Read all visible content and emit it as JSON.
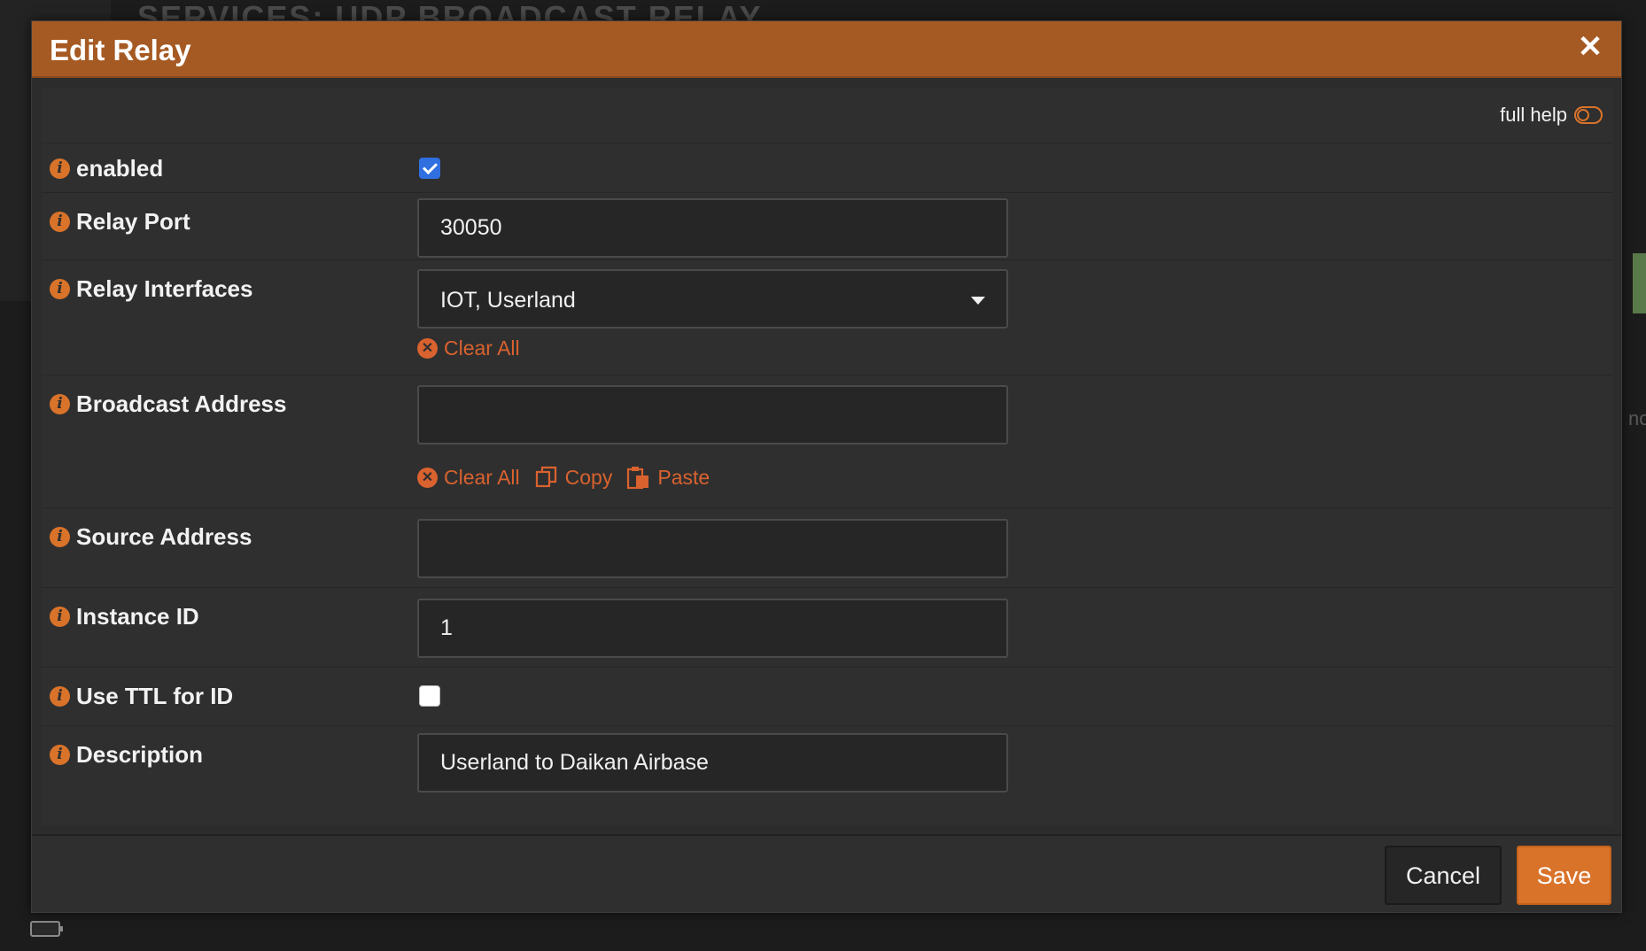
{
  "background": {
    "title_fragment": "SERVICES: UDP BROADCAST RELAY",
    "side_text": "no"
  },
  "modal": {
    "title": "Edit Relay",
    "close_glyph": "✕",
    "full_help_label": "full help",
    "fields": {
      "enabled": {
        "label": "enabled",
        "checked": true
      },
      "relay_port": {
        "label": "Relay Port",
        "value": "30050"
      },
      "relay_interfaces": {
        "label": "Relay Interfaces",
        "value": "IOT, Userland",
        "clear_all": "Clear All"
      },
      "broadcast_address": {
        "label": "Broadcast Address",
        "value": "",
        "clear_all": "Clear All",
        "copy": "Copy",
        "paste": "Paste"
      },
      "source_address": {
        "label": "Source Address",
        "value": ""
      },
      "instance_id": {
        "label": "Instance ID",
        "value": "1"
      },
      "use_ttl": {
        "label": "Use TTL for ID",
        "checked": false
      },
      "description": {
        "label": "Description",
        "value": "Userland to Daikan Airbase"
      }
    },
    "buttons": {
      "cancel": "Cancel",
      "save": "Save"
    }
  },
  "colors": {
    "accent": "#d9732a",
    "header": "#a65a23",
    "danger_link": "#d9622f",
    "checkbox_checked": "#2f6fe0"
  },
  "icons": {
    "info": "info-icon",
    "close": "close-icon",
    "clear": "clear-all-icon",
    "copy": "copy-icon",
    "paste": "paste-icon",
    "toggle": "toggle-icon",
    "dropdown": "chevron-down-icon"
  }
}
